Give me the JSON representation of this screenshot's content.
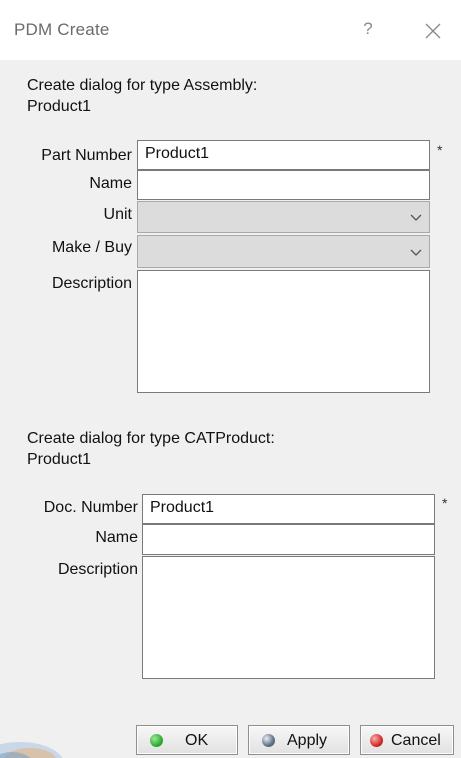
{
  "window": {
    "title": "PDM Create",
    "help_symbol": "?",
    "close_icon": "close-icon"
  },
  "assembly": {
    "heading_line1": "Create dialog for type Assembly:",
    "heading_line2": "Product1",
    "part_number_label": "Part Number",
    "part_number_value": "Product1",
    "part_number_required": "*",
    "name_label": "Name",
    "name_value": "",
    "unit_label": "Unit",
    "unit_value": "",
    "make_buy_label": "Make / Buy",
    "make_buy_value": "",
    "description_label": "Description",
    "description_value": ""
  },
  "catproduct": {
    "heading_line1": "Create dialog for type CATProduct:",
    "heading_line2": "Product1",
    "doc_number_label": "Doc. Number",
    "doc_number_value": "Product1",
    "doc_number_required": "*",
    "name_label": "Name",
    "name_value": "",
    "description_label": "Description",
    "description_value": ""
  },
  "buttons": {
    "ok_label": "OK",
    "apply_label": "Apply",
    "cancel_label": "Cancel"
  },
  "colors": {
    "ok_dot": "#2fae2f",
    "apply_dot": "#2a6fd1",
    "cancel_dot": "#d62b2b",
    "title_text": "#6b6b6b",
    "combo_bg": "#dcdcdc"
  }
}
